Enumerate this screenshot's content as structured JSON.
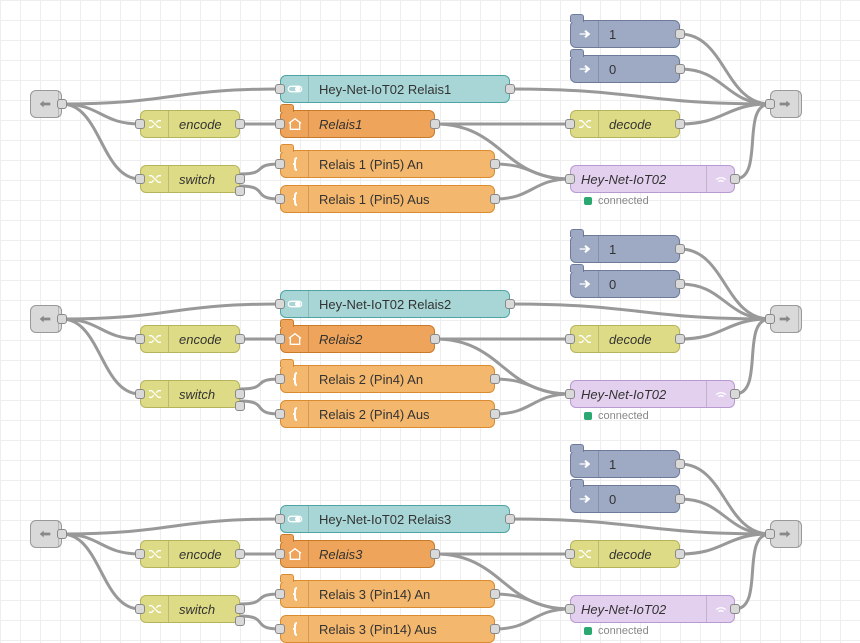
{
  "groups": [
    {
      "inject": {
        "label1": "1",
        "label0": "0"
      },
      "switchUi": "Hey-Net-IoT02 Relais1",
      "encode": "encode",
      "relais": "Relais1",
      "switch": "switch",
      "tplAn": "Relais 1 (Pin5) An",
      "tplAus": "Relais 1 (Pin5) Aus",
      "decode": "decode",
      "mqtt": "Hey-Net-IoT02",
      "mqttStatus": "connected"
    },
    {
      "inject": {
        "label1": "1",
        "label0": "0"
      },
      "switchUi": "Hey-Net-IoT02 Relais2",
      "encode": "encode",
      "relais": "Relais2",
      "switch": "switch",
      "tplAn": "Relais 2 (Pin4) An",
      "tplAus": "Relais 2 (Pin4) Aus",
      "decode": "decode",
      "mqtt": "Hey-Net-IoT02",
      "mqttStatus": "connected"
    },
    {
      "inject": {
        "label1": "1",
        "label0": "0"
      },
      "switchUi": "Hey-Net-IoT02 Relais3",
      "encode": "encode",
      "relais": "Relais3",
      "switch": "switch",
      "tplAn": "Relais 3 (Pin14) An",
      "tplAus": "Relais 3 (Pin14) Aus",
      "decode": "decode",
      "mqtt": "Hey-Net-IoT02",
      "mqttStatus": "connected"
    }
  ]
}
